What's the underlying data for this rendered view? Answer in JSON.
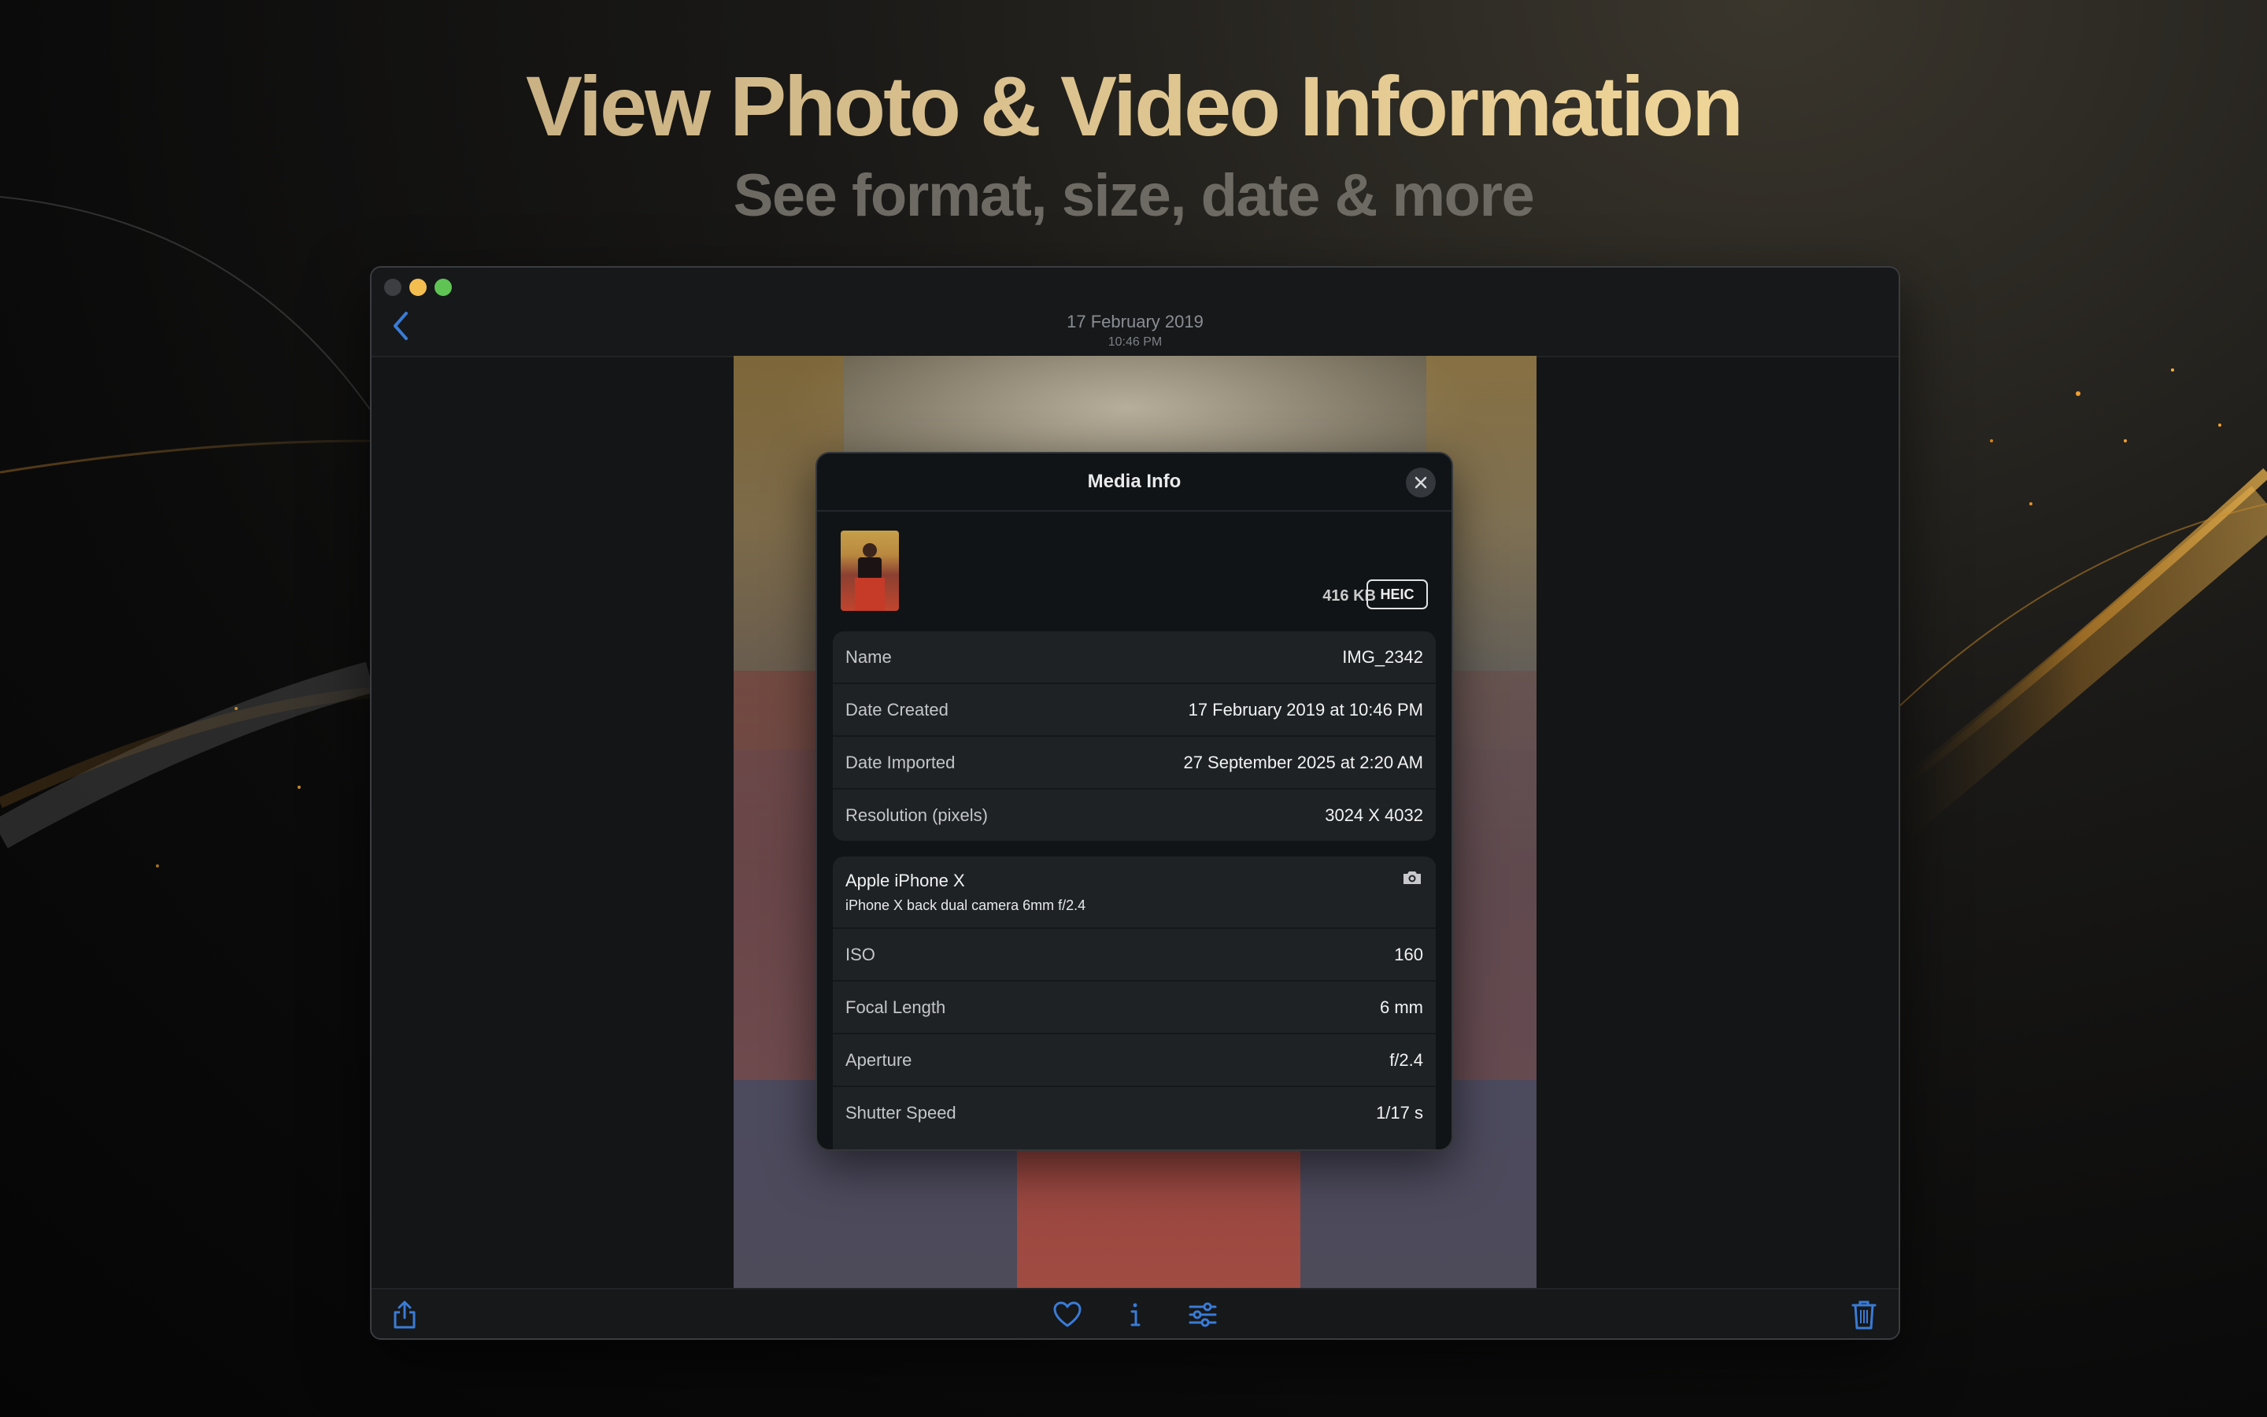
{
  "headline": "View Photo & Video Information",
  "subheadline": "See format, size, date & more",
  "window": {
    "title_date": "17 February 2019",
    "title_time": "10:46 PM"
  },
  "modal": {
    "title": "Media Info",
    "file_size": "416 KB",
    "format": "HEIC",
    "info_rows": [
      {
        "label": "Name",
        "value": "IMG_2342"
      },
      {
        "label": "Date Created",
        "value": "17 February 2019 at 10:46 PM"
      },
      {
        "label": "Date Imported",
        "value": "27 September 2025 at 2:20 AM"
      },
      {
        "label": "Resolution (pixels)",
        "value": "3024 X 4032"
      }
    ],
    "camera": {
      "model": "Apple iPhone X",
      "lens": "iPhone X back dual camera 6mm f/2.4",
      "icon": "camera-icon",
      "rows": [
        {
          "label": "ISO",
          "value": "160"
        },
        {
          "label": "Focal Length",
          "value": "6 mm"
        },
        {
          "label": "Aperture",
          "value": "f/2.4"
        },
        {
          "label": "Shutter Speed",
          "value": "1/17 s"
        }
      ]
    }
  },
  "toolbar": {
    "icons": [
      "share-icon",
      "heart-icon",
      "info-icon",
      "adjust-icon",
      "trash-icon"
    ]
  },
  "colors": {
    "accent": "#3a7bd5",
    "headline_gold": "#e3c88f",
    "subheadline_gray": "#6d6a63"
  }
}
